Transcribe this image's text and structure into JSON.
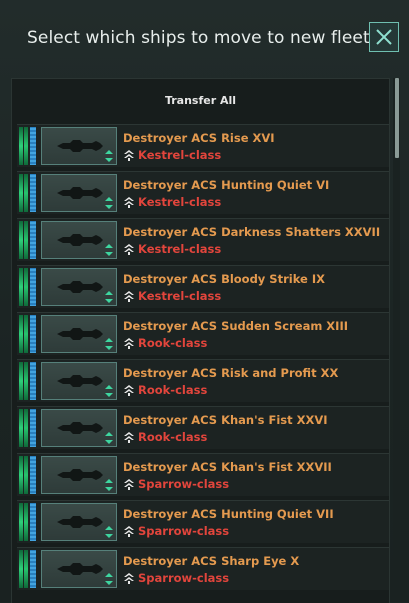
{
  "window": {
    "title": "Select which ships to move to new fleet",
    "close_icon": "close-x-icon"
  },
  "list": {
    "transfer_all_label": "Transfer All",
    "rows": [
      {
        "name": "Destroyer ACS Rise XVI",
        "class": "Kestrel-class"
      },
      {
        "name": "Destroyer ACS Hunting Quiet VI",
        "class": "Kestrel-class"
      },
      {
        "name": "Destroyer ACS Darkness Shatters XXVII",
        "class": "Kestrel-class"
      },
      {
        "name": "Destroyer ACS Bloody Strike IX",
        "class": "Kestrel-class"
      },
      {
        "name": "Destroyer ACS Sudden Scream XIII",
        "class": "Rook-class"
      },
      {
        "name": "Destroyer ACS Risk and Profit XX",
        "class": "Rook-class"
      },
      {
        "name": "Destroyer ACS Khan's Fist XXVI",
        "class": "Rook-class"
      },
      {
        "name": "Destroyer ACS Khan's Fist XXVII",
        "class": "Sparrow-class"
      },
      {
        "name": "Destroyer ACS Hunting Quiet VII",
        "class": "Sparrow-class"
      },
      {
        "name": "Destroyer ACS Sharp Eye X",
        "class": "Sparrow-class"
      }
    ]
  },
  "colors": {
    "ship_name": "#e49a4f",
    "ship_class": "#e2453c",
    "hull_bar": "#2fd07a",
    "shield_bar": "#4fb6f0",
    "accent": "#6fbfb0"
  }
}
